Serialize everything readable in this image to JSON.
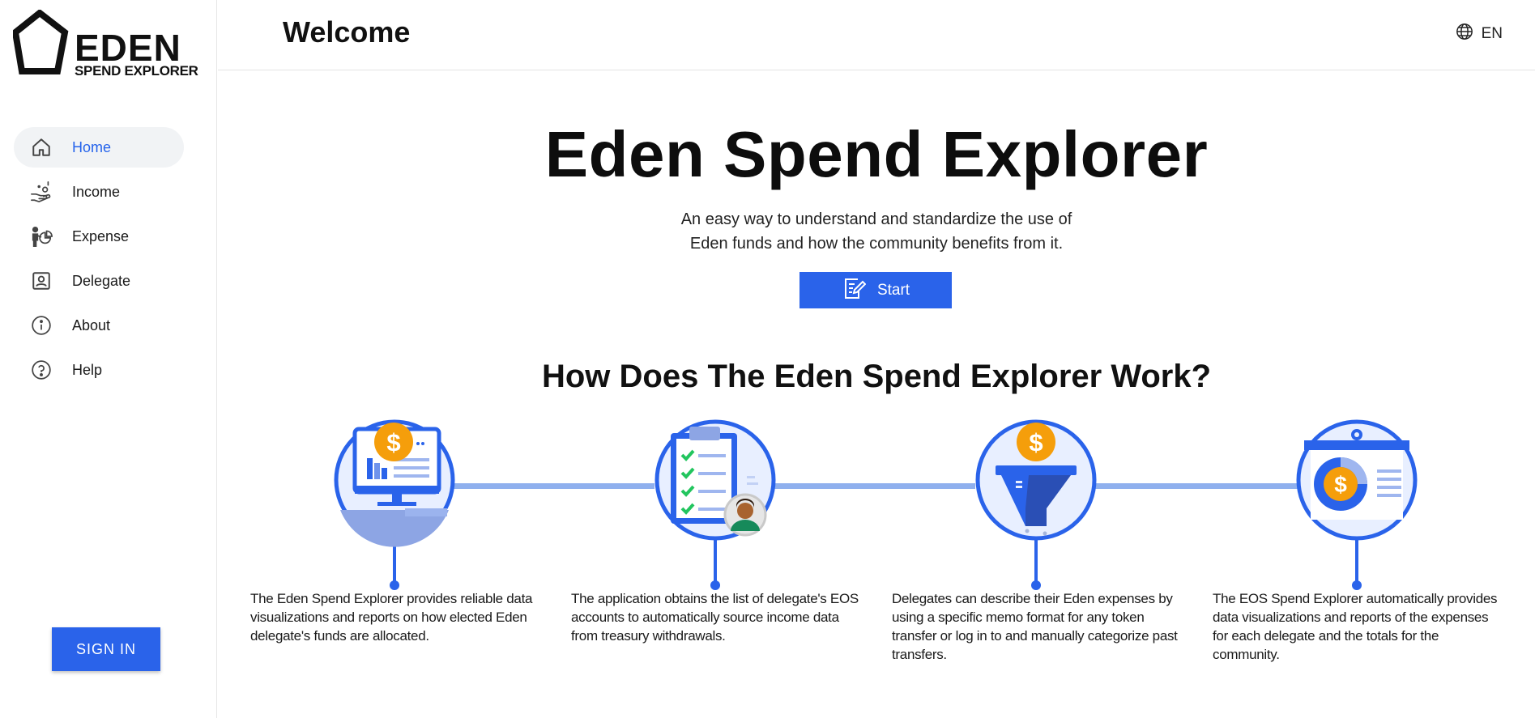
{
  "brand": {
    "logo_word": "EDEN",
    "logo_sub": "SPEND EXPLORER"
  },
  "sidebar": {
    "items": [
      {
        "label": "Home",
        "icon": "home-icon",
        "active": true
      },
      {
        "label": "Income",
        "icon": "income-icon",
        "active": false
      },
      {
        "label": "Expense",
        "icon": "expense-icon",
        "active": false
      },
      {
        "label": "Delegate",
        "icon": "delegate-icon",
        "active": false
      },
      {
        "label": "About",
        "icon": "info-icon",
        "active": false
      },
      {
        "label": "Help",
        "icon": "help-icon",
        "active": false
      }
    ],
    "signin_label": "SIGN IN"
  },
  "header": {
    "title": "Welcome",
    "language": "EN"
  },
  "hero": {
    "title": "Eden Spend Explorer",
    "subtitle_line1": "An easy way to understand and standardize the use of",
    "subtitle_line2": "Eden funds and how the community benefits from it.",
    "start_label": "Start"
  },
  "how": {
    "title": "How Does The Eden Spend Explorer Work?",
    "steps": [
      {
        "icon": "data-dashboard-icon",
        "text": "The Eden Spend Explorer provides reliable data visualizations and reports on how elected Eden delegate's funds are allocated."
      },
      {
        "icon": "checklist-icon",
        "text": "The application obtains the list of delegate's EOS accounts to automatically source income data from treasury withdrawals."
      },
      {
        "icon": "funnel-icon",
        "text": "Delegates can describe their Eden expenses by using a specific memo format for any token transfer or log in to and manually categorize past transfers."
      },
      {
        "icon": "report-icon",
        "text": "The EOS Spend Explorer automatically provides data visualizations and reports of the expenses for each delegate and the totals for the community."
      }
    ]
  },
  "colors": {
    "accent": "#2a63ea",
    "active_text": "#2563eb",
    "coin": "#f59e0b",
    "check": "#22c55e",
    "line": "#8fb0ee"
  }
}
